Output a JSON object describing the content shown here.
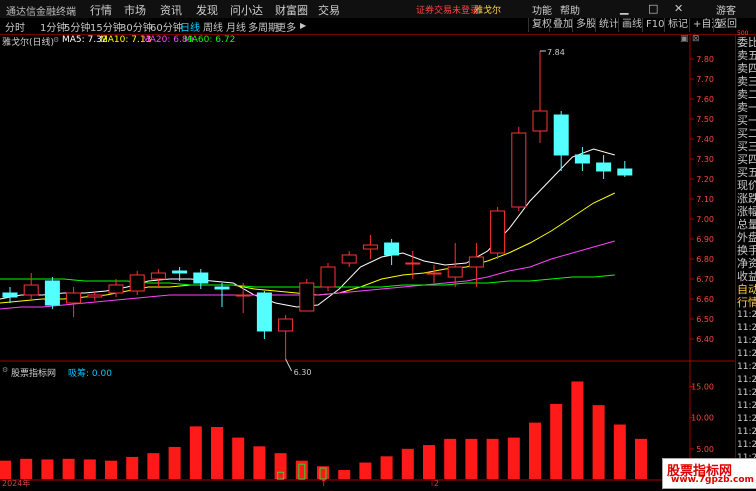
{
  "app": {
    "title": "通达信金融终端",
    "menu": [
      "行情",
      "市场",
      "资讯",
      "发现",
      "问小达",
      "财富圈",
      "交易"
    ],
    "status_text": "证券交易未登录",
    "stock_tab": "雅戈尔",
    "right_menu": [
      "功能",
      "帮助"
    ],
    "guest": "游客"
  },
  "periods": [
    "分时",
    "1分钟",
    "5分钟",
    "15分钟",
    "30分钟",
    "60分钟",
    "日线",
    "周线",
    "月线",
    "多周期",
    "更多"
  ],
  "active_period": "日线",
  "toolbar": [
    "复权",
    "叠加",
    "多股",
    "统计",
    "画线",
    "F10",
    "标记",
    "+自选",
    "返回"
  ],
  "info": {
    "name": "雅戈尔(日线)",
    "ma5": "MA5: 7.32",
    "ma10": "MA10: 7.13",
    "ma20": "MA20: 6.89",
    "ma60": "MA60: 6.72"
  },
  "indicator": {
    "name": "股票指标网",
    "value_label": "吸筹: 0.00"
  },
  "x_axis": {
    "label1": "2024年",
    "label2": "2"
  },
  "right_col_items": [
    "委比",
    "卖五",
    "卖四",
    "卖三",
    "卖二",
    "卖一",
    "买一",
    "买二",
    "买三",
    "买四",
    "买五",
    "现价",
    "涨跌",
    "涨幅",
    "总量",
    "外盘",
    "换手",
    "净资",
    "收益",
    "自动",
    "行情",
    "11:29",
    "11:29",
    "11:29",
    "11:29",
    "11:29",
    "11:29",
    "11:29",
    "11:29",
    "11:29",
    "11:29",
    "11:29",
    "11:29",
    "11:29",
    "11:29"
  ],
  "right_col_top": "500",
  "watermark": {
    "line1": "股票指标网",
    "line2": "www.7gpzb.com"
  },
  "colors": {
    "up": "#ff3232",
    "down": "#54ffff",
    "ma5": "#ffffff",
    "ma10": "#ffff00",
    "ma20": "#ff44ff",
    "ma60": "#00ff00",
    "hist": "#ff1a1a",
    "axis": "#aa0000"
  },
  "chart_data": [
    {
      "type": "candlestick",
      "title": "雅戈尔(日线)",
      "ylim": [
        6.4,
        7.84
      ],
      "y_ticks": [
        6.4,
        6.5,
        6.6,
        6.7,
        6.8,
        6.9,
        7.0,
        7.1,
        7.2,
        7.3,
        7.4,
        7.5,
        7.6,
        7.7,
        7.8
      ],
      "annotations": {
        "high_label": "7.84",
        "low_label": "6.30"
      },
      "candles": [
        {
          "o": 6.63,
          "c": 6.61,
          "h": 6.66,
          "l": 6.58
        },
        {
          "o": 6.62,
          "c": 6.67,
          "h": 6.73,
          "l": 6.6
        },
        {
          "o": 6.69,
          "c": 6.57,
          "h": 6.71,
          "l": 6.55
        },
        {
          "o": 6.58,
          "c": 6.63,
          "h": 6.66,
          "l": 6.51
        },
        {
          "o": 6.61,
          "c": 6.62,
          "h": 6.64,
          "l": 6.59
        },
        {
          "o": 6.63,
          "c": 6.67,
          "h": 6.7,
          "l": 6.61
        },
        {
          "o": 6.64,
          "c": 6.72,
          "h": 6.74,
          "l": 6.62
        },
        {
          "o": 6.7,
          "c": 6.73,
          "h": 6.75,
          "l": 6.66
        },
        {
          "o": 6.74,
          "c": 6.73,
          "h": 6.76,
          "l": 6.69
        },
        {
          "o": 6.73,
          "c": 6.68,
          "h": 6.75,
          "l": 6.65
        },
        {
          "o": 6.66,
          "c": 6.65,
          "h": 6.68,
          "l": 6.56
        },
        {
          "o": 6.62,
          "c": 6.62,
          "h": 6.68,
          "l": 6.53
        },
        {
          "o": 6.63,
          "c": 6.44,
          "h": 6.64,
          "l": 6.4
        },
        {
          "o": 6.44,
          "c": 6.5,
          "h": 6.52,
          "l": 6.3
        },
        {
          "o": 6.54,
          "c": 6.68,
          "h": 6.7,
          "l": 6.54
        },
        {
          "o": 6.66,
          "c": 6.76,
          "h": 6.78,
          "l": 6.64
        },
        {
          "o": 6.78,
          "c": 6.82,
          "h": 6.84,
          "l": 6.76
        },
        {
          "o": 6.85,
          "c": 6.87,
          "h": 6.92,
          "l": 6.8
        },
        {
          "o": 6.88,
          "c": 6.82,
          "h": 6.9,
          "l": 6.77
        },
        {
          "o": 6.78,
          "c": 6.78,
          "h": 6.84,
          "l": 6.7
        },
        {
          "o": 6.73,
          "c": 6.73,
          "h": 6.77,
          "l": 6.68
        },
        {
          "o": 6.71,
          "c": 6.76,
          "h": 6.88,
          "l": 6.66
        },
        {
          "o": 6.76,
          "c": 6.81,
          "h": 6.88,
          "l": 6.66
        },
        {
          "o": 6.83,
          "c": 7.04,
          "h": 7.06,
          "l": 6.8
        },
        {
          "o": 7.06,
          "c": 7.43,
          "h": 7.46,
          "l": 7.04
        },
        {
          "o": 7.44,
          "c": 7.54,
          "h": 7.84,
          "l": 7.38
        },
        {
          "o": 7.52,
          "c": 7.32,
          "h": 7.54,
          "l": 7.24
        },
        {
          "o": 7.32,
          "c": 7.28,
          "h": 7.36,
          "l": 7.24
        },
        {
          "o": 7.28,
          "c": 7.24,
          "h": 7.32,
          "l": 7.2
        },
        {
          "o": 7.25,
          "c": 7.22,
          "h": 7.29,
          "l": 7.21
        }
      ],
      "ma": {
        "MA5": [
          6.6,
          6.62,
          6.62,
          6.63,
          6.63,
          6.64,
          6.66,
          6.69,
          6.7,
          6.7,
          6.69,
          6.68,
          6.62,
          6.58,
          6.56,
          6.57,
          6.65,
          6.76,
          6.81,
          6.83,
          6.79,
          6.77,
          6.78,
          6.84,
          6.95,
          7.09,
          7.2,
          7.31,
          7.35,
          7.32
        ],
        "MA10": [
          6.58,
          6.59,
          6.6,
          6.6,
          6.61,
          6.62,
          6.64,
          6.66,
          6.66,
          6.67,
          6.67,
          6.67,
          6.65,
          6.64,
          6.63,
          6.62,
          6.63,
          6.66,
          6.7,
          6.72,
          6.73,
          6.75,
          6.76,
          6.79,
          6.83,
          6.88,
          6.94,
          7.01,
          7.08,
          7.13
        ],
        "MA20": [
          6.55,
          6.56,
          6.56,
          6.57,
          6.58,
          6.59,
          6.6,
          6.61,
          6.62,
          6.62,
          6.62,
          6.62,
          6.62,
          6.62,
          6.62,
          6.62,
          6.63,
          6.64,
          6.65,
          6.66,
          6.67,
          6.68,
          6.69,
          6.71,
          6.74,
          6.76,
          6.8,
          6.83,
          6.86,
          6.89
        ],
        "MA60": [
          6.7,
          6.7,
          6.7,
          6.7,
          6.69,
          6.69,
          6.69,
          6.68,
          6.68,
          6.67,
          6.67,
          6.67,
          6.66,
          6.66,
          6.66,
          6.66,
          6.66,
          6.66,
          6.66,
          6.67,
          6.67,
          6.67,
          6.68,
          6.68,
          6.69,
          6.69,
          6.7,
          6.71,
          6.71,
          6.72
        ]
      }
    },
    {
      "type": "bar",
      "title": "股票指标网",
      "ylim": [
        0,
        17
      ],
      "y_ticks": [
        5.0,
        10.0,
        15.0
      ],
      "values": [
        3.1,
        3.4,
        3.3,
        3.4,
        3.3,
        3.1,
        3.7,
        4.3,
        5.3,
        8.6,
        8.5,
        6.8,
        5.4,
        4.3,
        3.1,
        2.2,
        1.6,
        2.8,
        3.8,
        5.0,
        5.6,
        6.6,
        6.6,
        6.6,
        6.8,
        9.2,
        12.2,
        15.8,
        12.0,
        8.9,
        6.6
      ],
      "hollow_down": [
        0,
        0,
        0,
        0,
        0,
        0,
        0,
        0,
        0,
        0,
        0,
        0,
        3.2,
        5.7,
        5.8,
        4.2,
        0,
        0,
        0,
        0,
        0,
        0,
        0,
        0,
        0,
        0,
        0,
        0,
        0,
        0,
        0
      ]
    }
  ]
}
